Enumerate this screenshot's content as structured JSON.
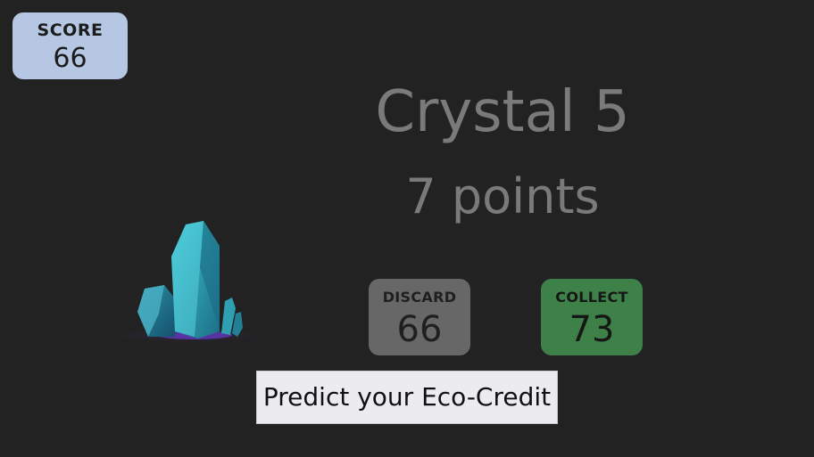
{
  "score": {
    "label": "SCORE",
    "value": "66"
  },
  "item": {
    "title": "Crystal 5",
    "points": "7 points",
    "image": "crystal-cluster-icon"
  },
  "choices": {
    "discard": {
      "label": "DISCARD",
      "value": "66"
    },
    "collect": {
      "label": "COLLECT",
      "value": "73"
    }
  },
  "predict_button": {
    "label": "Predict your Eco-Credit"
  },
  "colors": {
    "background": "#222222",
    "score_panel": "#b5c7e3",
    "discard_panel": "#676767",
    "collect_panel": "#3d8148",
    "title_text": "#7a7a7a",
    "crystal": "#2aa5b5"
  }
}
